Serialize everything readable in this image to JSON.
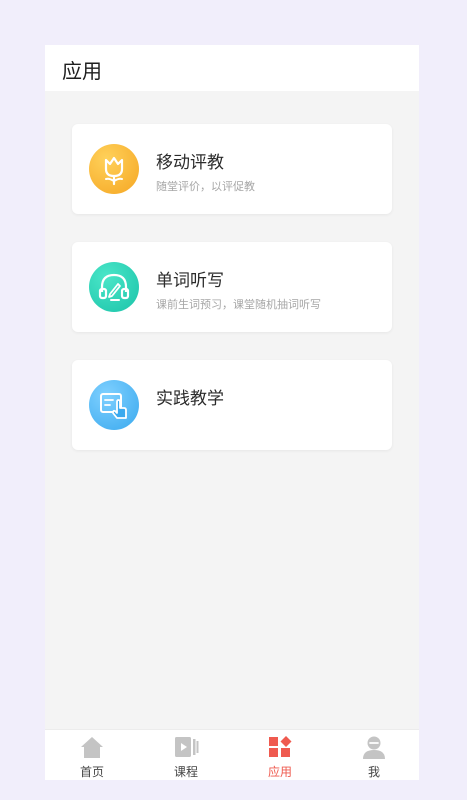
{
  "header": {
    "title": "应用"
  },
  "cards": [
    {
      "title": "移动评教",
      "subtitle": "随堂评价，以评促教",
      "icon": "tulip-icon",
      "color": "#f7b731"
    },
    {
      "title": "单词听写",
      "subtitle": "课前生词预习，课堂随机抽词听写",
      "icon": "headphones-pen-icon",
      "color": "#27d0b4"
    },
    {
      "title": "实践教学",
      "subtitle": "",
      "icon": "touch-screen-icon",
      "color": "#40b3f2"
    }
  ],
  "tabbar": {
    "items": [
      {
        "label": "首页",
        "icon": "home-icon",
        "active": false
      },
      {
        "label": "课程",
        "icon": "video-icon",
        "active": false
      },
      {
        "label": "应用",
        "icon": "apps-grid-icon",
        "active": true
      },
      {
        "label": "我",
        "icon": "profile-icon",
        "active": false
      }
    ],
    "active_color": "#ef5a4f",
    "inactive_color": "#c4c4c4"
  }
}
